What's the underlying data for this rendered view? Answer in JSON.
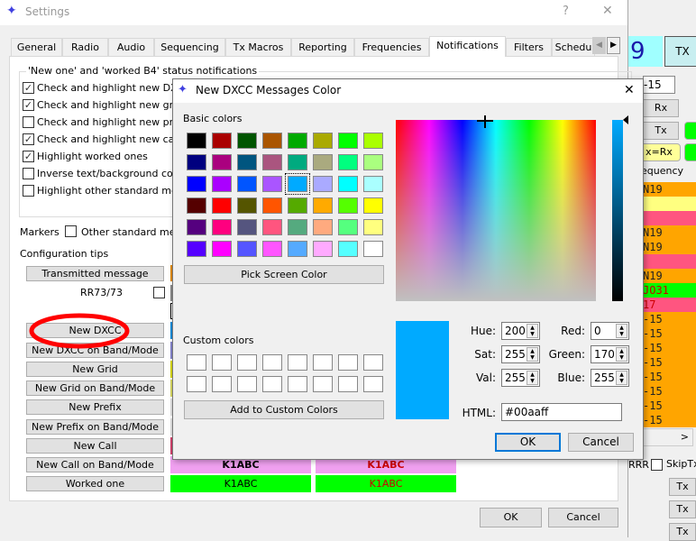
{
  "settings": {
    "title": "Settings",
    "help": "?",
    "close": "✕",
    "tabs": [
      {
        "label": "General"
      },
      {
        "label": "Radio"
      },
      {
        "label": "Audio"
      },
      {
        "label": "Sequencing"
      },
      {
        "label": "Tx Macros"
      },
      {
        "label": "Reporting"
      },
      {
        "label": "Frequencies"
      },
      {
        "label": "Notifications",
        "active": true
      },
      {
        "label": "Filters"
      },
      {
        "label": "Schedu"
      }
    ],
    "group_title": "'New one' and 'worked B4' status notifications",
    "checks": [
      {
        "label": "Check and highlight new DXCC",
        "checked": true
      },
      {
        "label": "Check and highlight new grids",
        "checked": true
      },
      {
        "label": "Check and highlight new prefixes",
        "checked": false
      },
      {
        "label": "Check and highlight new calls",
        "checked": true
      },
      {
        "label": "Highlight worked ones",
        "checked": true
      },
      {
        "label": "Inverse text/background color",
        "checked": false
      },
      {
        "label": "Highlight other standard messages",
        "checked": false
      }
    ],
    "markers_label": "Markers",
    "markers_check": "Other standard messages",
    "config_tips": "Configuration tips",
    "transmitted": "Transmitted message",
    "rr73": "RR73/73",
    "buttons": [
      "New DXCC",
      "New DXCC on Band/Mode",
      "New Grid",
      "New Grid on Band/Mode",
      "New Prefix",
      "New Prefix on Band/Mode",
      "New Call",
      "New Call on Band/Mode",
      "Worked one"
    ],
    "swatch_colors": [
      "#0a8ad8",
      "#8484cc",
      "#d8d800",
      "#d8d860",
      "#e0e0e0",
      "#e0e0e0",
      "#d0406a",
      "#f0a0f0",
      "#00ff00"
    ],
    "sample_call": "K1ABC",
    "ok": "OK",
    "cancel": "Cancel"
  },
  "dialog": {
    "title": "New DXCC Messages Color",
    "close": "✕",
    "basic_label": "Basic colors",
    "basic_colors": [
      [
        "#000000",
        "#aa0000",
        "#005500",
        "#aa5500",
        "#00aa00",
        "#aaaa00",
        "#00ff00",
        "#aaff00"
      ],
      [
        "#00007f",
        "#aa007f",
        "#00557f",
        "#aa557f",
        "#00aa7f",
        "#aaaa7f",
        "#00ff7f",
        "#aaff7f"
      ],
      [
        "#0000ff",
        "#aa00ff",
        "#0055ff",
        "#aa55ff",
        "#00aaff",
        "#aaaaff",
        "#00ffff",
        "#aaffff"
      ],
      [
        "#550000",
        "#ff0000",
        "#555500",
        "#ff5500",
        "#55aa00",
        "#ffaa00",
        "#55ff00",
        "#ffff00"
      ],
      [
        "#55007f",
        "#ff007f",
        "#55557f",
        "#ff557f",
        "#55aa7f",
        "#ffaa7f",
        "#55ff7f",
        "#ffff7f"
      ],
      [
        "#5500ff",
        "#ff00ff",
        "#5555ff",
        "#ff55ff",
        "#55aaff",
        "#ffaaff",
        "#55ffff",
        "#ffffff"
      ]
    ],
    "selected": "#00aaff",
    "pick_screen": "Pick Screen Color",
    "custom_label": "Custom colors",
    "add_custom": "Add to Custom Colors",
    "hue_label": "Hue:",
    "hue": "200",
    "sat_label": "Sat:",
    "sat": "255",
    "val_label": "Val:",
    "val": "255",
    "red_label": "Red:",
    "red": "0",
    "green_label": "Green:",
    "green": "170",
    "blue_label": "Blue:",
    "blue": "255",
    "html_label": "HTML:",
    "html": "#00aaff",
    "ok": "OK",
    "cancel": "Cancel"
  },
  "main": {
    "freq_digit": "9",
    "tx_label": "TX",
    "report": "-15",
    "rx": "Rx",
    "tx": "Tx",
    "txrx": "x=Rx",
    "frequency_header": "equency",
    "rows": [
      {
        "text": "N19",
        "color": "#ffa500"
      },
      {
        "text": "",
        "color": "#ffff80"
      },
      {
        "text": "",
        "color": "#ff5580"
      },
      {
        "text": "N19",
        "color": "#ffa500"
      },
      {
        "text": "N19",
        "color": "#ffa500"
      },
      {
        "text": "",
        "color": "#ff5580"
      },
      {
        "text": "N19",
        "color": "#ffa500"
      },
      {
        "text": "JO31",
        "color": "#00ff00",
        "textcolor": "#cc0000"
      },
      {
        "text": "17",
        "color": "#ff5580",
        "textcolor": "#cc0000"
      },
      {
        "text": "-15",
        "color": "#ffa500"
      },
      {
        "text": "-15",
        "color": "#ffa500"
      },
      {
        "text": "-15",
        "color": "#ffa500"
      },
      {
        "text": "-15",
        "color": "#ffa500"
      },
      {
        "text": "-15",
        "color": "#ffa500"
      },
      {
        "text": "-15",
        "color": "#ffa500"
      },
      {
        "text": "-15",
        "color": "#ffa500"
      },
      {
        "text": "-15",
        "color": "#ffa500"
      }
    ],
    "rrr": "RRR",
    "skiptx": "SkipTx",
    "tx_btn": "Tx"
  }
}
